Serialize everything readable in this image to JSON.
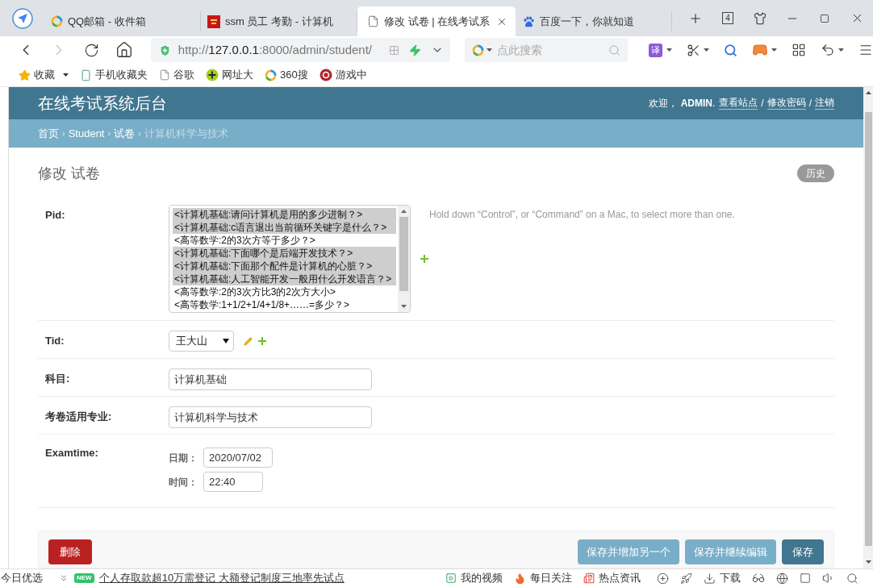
{
  "browser": {
    "tabs": [
      {
        "title": "QQ邮箱 - 收件箱",
        "selected": false
      },
      {
        "title": "ssm 员工 考勤 - 计算机",
        "selected": false
      },
      {
        "title": "修改 试卷 | 在线考试系",
        "selected": true
      },
      {
        "title": "百度一下，你就知道",
        "selected": false
      }
    ],
    "tab_count": "4",
    "nav": [
      {
        "kind": "back",
        "disabled": false
      },
      {
        "kind": "forward",
        "disabled": true
      },
      {
        "kind": "reload",
        "disabled": false
      },
      {
        "kind": "home",
        "disabled": false
      }
    ],
    "url": {
      "scheme": "http://",
      "host": "127.0.0.1",
      "path": ":8000/admin/student/"
    },
    "search": {
      "placeholder": "点此搜索"
    },
    "translate_label": "译"
  },
  "bookmarks": [
    {
      "label": "收藏",
      "dropdown": true
    },
    {
      "label": "手机收藏夹",
      "dropdown": false
    },
    {
      "label": "谷歌",
      "dropdown": false
    },
    {
      "label": "网址大",
      "dropdown": false
    },
    {
      "label": "360搜",
      "dropdown": false
    },
    {
      "label": "游戏中",
      "dropdown": false
    }
  ],
  "header": {
    "site_title": "在线考试系统后台",
    "greeting": "欢迎， **ADMIN**.",
    "links": [
      {
        "label": "查看站点"
      },
      {
        "label": "修改密码",
        "separator": "/"
      },
      {
        "label": "注销",
        "separator": "/"
      }
    ]
  },
  "breadcrumbs": [
    {
      "label": "首页",
      "current": false
    },
    {
      "label": "Student",
      "separator": "›",
      "current": false
    },
    {
      "label": "试卷",
      "separator": "›",
      "current": false
    },
    {
      "label": "计算机科学与技术",
      "separator": "›",
      "current": true
    }
  ],
  "page": {
    "title": "修改 试卷",
    "history_button": "历史"
  },
  "form": {
    "fields": [
      {
        "kind": "multiselect",
        "label": "Pid:",
        "options": [
          {
            "text": "<计算机基础:请问计算机是用的多少进制？>",
            "selected": true
          },
          {
            "text": "<计算机基础:c语言退出当前循环关键字是什么？>",
            "selected": true
          },
          {
            "text": "<高等数学:2的3次方等于多少？>",
            "selected": false
          },
          {
            "text": "<计算机基础:下面哪个是后端开发技术？>",
            "selected": true
          },
          {
            "text": "<计算机基础:下面那个配件是计算机的心脏？>",
            "selected": true
          },
          {
            "text": "<计算机基础:人工智能开发一般用什么开发语言？>",
            "selected": true
          },
          {
            "text": "<高等数学:2的3次方比3的2次方大小>",
            "selected": false
          },
          {
            "text": "<高等数学:1+1/2+1/4+1/8+……=多少？>",
            "selected": false
          }
        ],
        "help": "Hold down “Control”, or “Command” on a Mac, to select more than one."
      },
      {
        "kind": "select",
        "label": "Tid:",
        "value": "王大山"
      },
      {
        "kind": "text",
        "label": "科目:",
        "value": "计算机基础"
      },
      {
        "kind": "text",
        "label": "考卷适用专业:",
        "value": "计算机科学与技术"
      },
      {
        "kind": "datetime",
        "label": "Examtime:",
        "date_label": "日期：",
        "date": "2020/07/02",
        "time_label": "时间：",
        "time": "22:40"
      }
    ]
  },
  "submit_row": {
    "delete_button": "删除",
    "buttons": [
      {
        "label": "保存并增加另一个",
        "kind": "secondary"
      },
      {
        "label": "保存并继续编辑",
        "kind": "secondary"
      },
      {
        "label": "保存",
        "kind": "default"
      }
    ]
  },
  "status_bar": {
    "left_label": "今日优选",
    "badge": "NEW",
    "headline": "个人存取款超10万需登记 大额登记制度三地率先试点",
    "items": [
      {
        "label": "我的视频"
      },
      {
        "label": "每日关注"
      },
      {
        "label": "热点资讯"
      }
    ],
    "download": "下载"
  }
}
